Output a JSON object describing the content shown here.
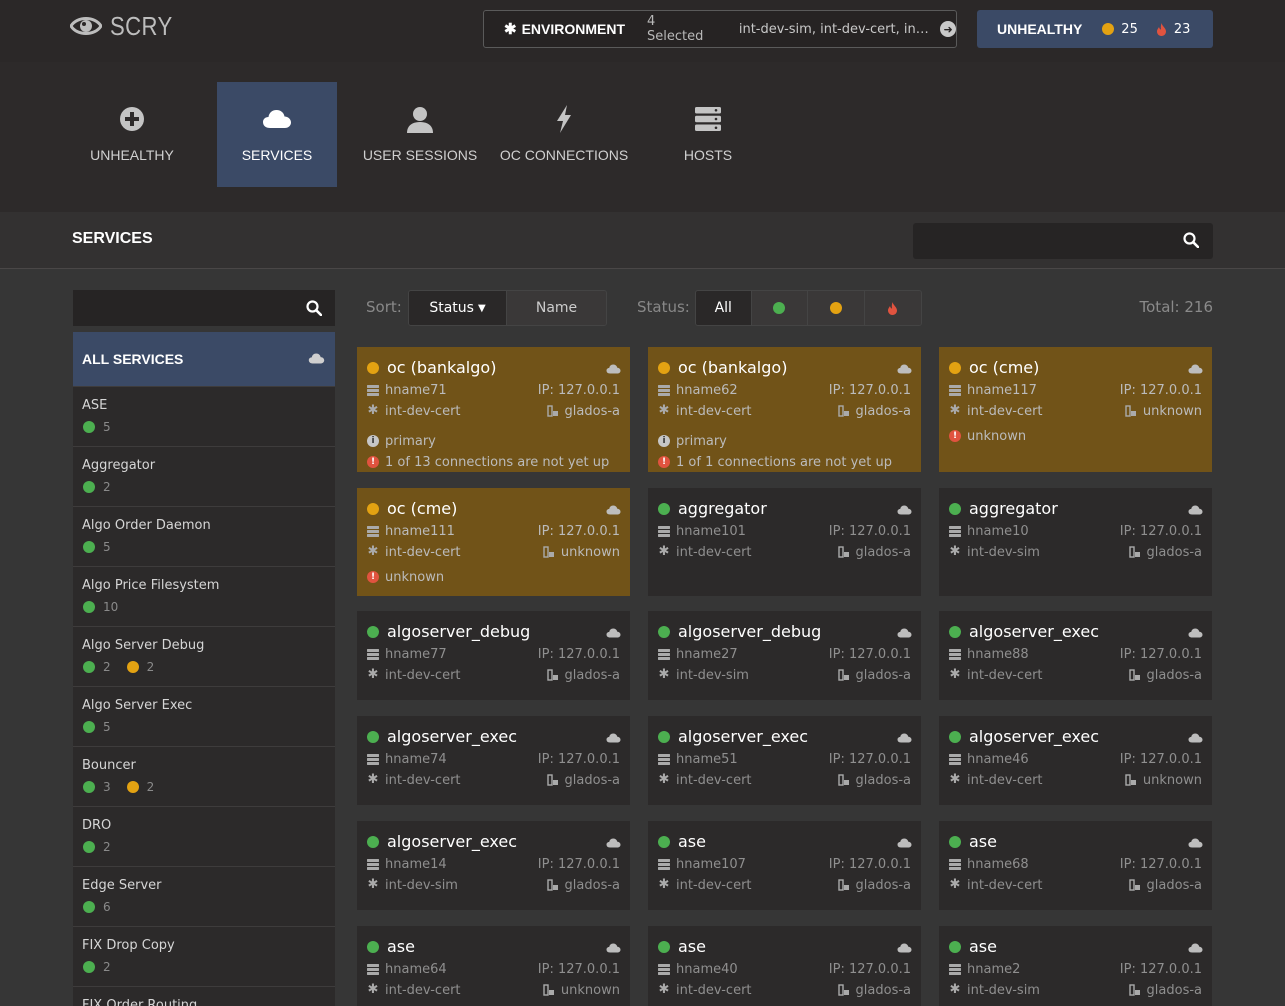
{
  "app": {
    "title": "SCRY"
  },
  "header": {
    "env_label": "ENVIRONMENT",
    "env_count": "4 Selected",
    "env_list": "int-dev-sim, int-dev-cert, int-de...",
    "unhealthy_label": "UNHEALTHY",
    "unhealthy_warn": "25",
    "unhealthy_crit": "23"
  },
  "nav": [
    {
      "label": "UNHEALTHY",
      "icon": "plus-circle-icon",
      "active": false
    },
    {
      "label": "SERVICES",
      "icon": "cloud-icon",
      "active": true
    },
    {
      "label": "USER SESSIONS",
      "icon": "user-icon",
      "active": false
    },
    {
      "label": "OC CONNECTIONS",
      "icon": "lightning-icon",
      "active": false
    },
    {
      "label": "HOSTS",
      "icon": "server-icon",
      "active": false
    }
  ],
  "section": {
    "title": "SERVICES",
    "search_placeholder": ""
  },
  "sidebar": {
    "search_placeholder": "",
    "all_label": "ALL SERVICES",
    "items": [
      {
        "name": "ASE",
        "green": "5",
        "orange": ""
      },
      {
        "name": "Aggregator",
        "green": "2",
        "orange": ""
      },
      {
        "name": "Algo Order Daemon",
        "green": "5",
        "orange": ""
      },
      {
        "name": "Algo Price Filesystem",
        "green": "10",
        "orange": ""
      },
      {
        "name": "Algo Server Debug",
        "green": "2",
        "orange": "2"
      },
      {
        "name": "Algo Server Exec",
        "green": "5",
        "orange": ""
      },
      {
        "name": "Bouncer",
        "green": "3",
        "orange": "2"
      },
      {
        "name": "DRO",
        "green": "2",
        "orange": ""
      },
      {
        "name": "Edge Server",
        "green": "6",
        "orange": ""
      },
      {
        "name": "FIX Drop Copy",
        "green": "2",
        "orange": ""
      },
      {
        "name": "FIX Order Routing",
        "green": "",
        "orange": ""
      }
    ]
  },
  "toolbar": {
    "sort_label": "Sort:",
    "sort_status": "Status",
    "sort_name": "Name",
    "status_label": "Status:",
    "status_all": "All",
    "total": "Total: 216"
  },
  "cards": [
    {
      "name": "oc (bankalgo)",
      "status": "orange",
      "host": "hname71",
      "ip": "IP: 127.0.0.1",
      "env": "int-dev-cert",
      "node": "glados-a",
      "extra": [
        {
          "type": "info",
          "text": "primary"
        },
        {
          "type": "alert",
          "text": "1 of 13 connections are not yet up"
        }
      ]
    },
    {
      "name": "oc (bankalgo)",
      "status": "orange",
      "host": "hname62",
      "ip": "IP: 127.0.0.1",
      "env": "int-dev-cert",
      "node": "glados-a",
      "extra": [
        {
          "type": "info",
          "text": "primary"
        },
        {
          "type": "alert",
          "text": "1 of 1 connections are not yet up"
        }
      ]
    },
    {
      "name": "oc (cme)",
      "status": "orange",
      "host": "hname117",
      "ip": "IP: 127.0.0.1",
      "env": "int-dev-cert",
      "node": "unknown",
      "extra": [
        {
          "type": "alert",
          "text": "unknown"
        }
      ]
    },
    {
      "name": "oc (cme)",
      "status": "orange",
      "host": "hname111",
      "ip": "IP: 127.0.0.1",
      "env": "int-dev-cert",
      "node": "unknown",
      "extra": [
        {
          "type": "alert",
          "text": "unknown"
        }
      ]
    },
    {
      "name": "aggregator",
      "status": "green",
      "host": "hname101",
      "ip": "IP: 127.0.0.1",
      "env": "int-dev-cert",
      "node": "glados-a",
      "extra": []
    },
    {
      "name": "aggregator",
      "status": "green",
      "host": "hname10",
      "ip": "IP: 127.0.0.1",
      "env": "int-dev-sim",
      "node": "glados-a",
      "extra": []
    },
    {
      "name": "algoserver_debug",
      "status": "green",
      "host": "hname77",
      "ip": "IP: 127.0.0.1",
      "env": "int-dev-cert",
      "node": "glados-a",
      "extra": []
    },
    {
      "name": "algoserver_debug",
      "status": "green",
      "host": "hname27",
      "ip": "IP: 127.0.0.1",
      "env": "int-dev-sim",
      "node": "glados-a",
      "extra": []
    },
    {
      "name": "algoserver_exec",
      "status": "green",
      "host": "hname88",
      "ip": "IP: 127.0.0.1",
      "env": "int-dev-cert",
      "node": "glados-a",
      "extra": []
    },
    {
      "name": "algoserver_exec",
      "status": "green",
      "host": "hname74",
      "ip": "IP: 127.0.0.1",
      "env": "int-dev-cert",
      "node": "glados-a",
      "extra": []
    },
    {
      "name": "algoserver_exec",
      "status": "green",
      "host": "hname51",
      "ip": "IP: 127.0.0.1",
      "env": "int-dev-cert",
      "node": "glados-a",
      "extra": []
    },
    {
      "name": "algoserver_exec",
      "status": "green",
      "host": "hname46",
      "ip": "IP: 127.0.0.1",
      "env": "int-dev-cert",
      "node": "unknown",
      "extra": []
    },
    {
      "name": "algoserver_exec",
      "status": "green",
      "host": "hname14",
      "ip": "IP: 127.0.0.1",
      "env": "int-dev-sim",
      "node": "glados-a",
      "extra": []
    },
    {
      "name": "ase",
      "status": "green",
      "host": "hname107",
      "ip": "IP: 127.0.0.1",
      "env": "int-dev-cert",
      "node": "glados-a",
      "extra": []
    },
    {
      "name": "ase",
      "status": "green",
      "host": "hname68",
      "ip": "IP: 127.0.0.1",
      "env": "int-dev-cert",
      "node": "glados-a",
      "extra": []
    },
    {
      "name": "ase",
      "status": "green",
      "host": "hname64",
      "ip": "IP: 127.0.0.1",
      "env": "int-dev-cert",
      "node": "unknown",
      "extra": []
    },
    {
      "name": "ase",
      "status": "green",
      "host": "hname40",
      "ip": "IP: 127.0.0.1",
      "env": "int-dev-cert",
      "node": "glados-a",
      "extra": []
    },
    {
      "name": "ase",
      "status": "green",
      "host": "hname2",
      "ip": "IP: 127.0.0.1",
      "env": "int-dev-sim",
      "node": "glados-a",
      "extra": []
    }
  ],
  "colors": {
    "accent": "#3b4a66",
    "warn_card": "#715318",
    "green": "#4caf50",
    "orange": "#e3a212",
    "red": "#e0533f"
  }
}
